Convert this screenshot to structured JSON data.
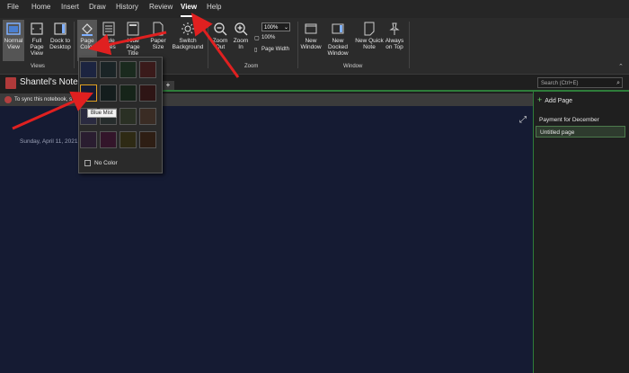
{
  "menu": [
    "File",
    "Home",
    "Insert",
    "Draw",
    "History",
    "Review",
    "View",
    "Help"
  ],
  "ribbon": {
    "views": {
      "normal": "Normal View",
      "full_page": "Full Page View",
      "dock": "Dock to Desktop",
      "group": "Views"
    },
    "page_color": "Page Color",
    "rule_lines": "Rule Lines",
    "hide_title": "Hide Page Title",
    "paper_size": "Paper Size",
    "switch_bg": "Switch Background",
    "zoom_out": "Zoom Out",
    "zoom_in": "Zoom In",
    "zoom_value": "100%",
    "zoom_100": "100%",
    "page_width": "Page Width",
    "zoom_group": "Zoom",
    "new_window": "New Window",
    "new_docked": "New Docked Window",
    "new_quick": "New Quick Note",
    "always_top": "Always on Top",
    "window_group": "Window"
  },
  "notebook": {
    "title": "Shantel's Notel",
    "sync_text": "To sync this notebook, s",
    "date": "Sunday, April 11, 2021"
  },
  "search": {
    "placeholder": "Search (Ctrl+E)"
  },
  "pages": {
    "add_label": "Add Page",
    "items": [
      "Payment for December",
      "Untitled page"
    ]
  },
  "page_color_menu": {
    "swatches": [
      "#1c2440",
      "#1a2426",
      "#1a2a1e",
      "#3a1a1a",
      "#151b33",
      "#141d1d",
      "#162419",
      "#2e1515",
      "#2a2a40",
      "#262c2c",
      "#2a3024",
      "#3a2c24",
      "#2a1d30",
      "#33152a",
      "#2e2a14",
      "#2e1e14"
    ],
    "tooltip": "Blue Mist",
    "no_color": "No Color"
  },
  "colors": {
    "accent": "#2e7d3a",
    "annotation_arrow": "#e02020",
    "selected_border": "#e0a020"
  }
}
